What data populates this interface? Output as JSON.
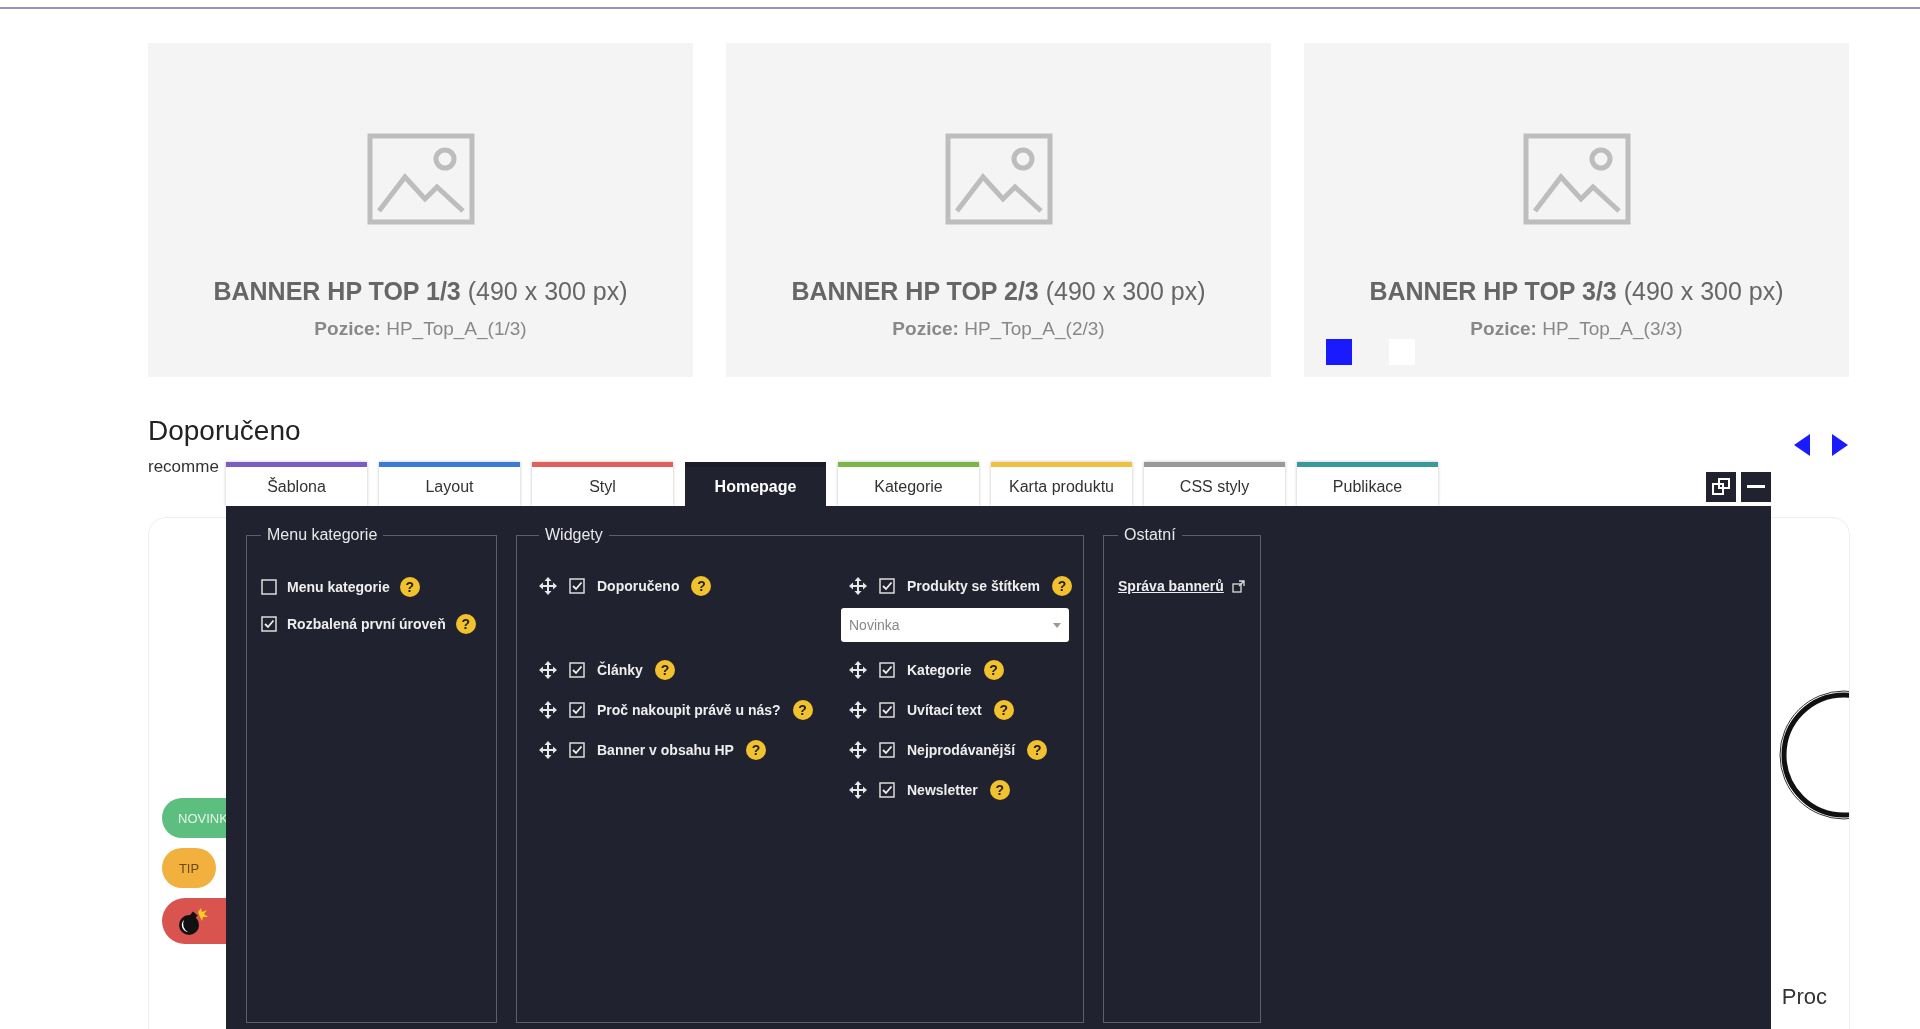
{
  "banners": [
    {
      "title": "**BANNER HP TOP 1/3** (490 x 300 px)",
      "position": "**Pozice:** HP_Top_A_(1/3)"
    },
    {
      "title": "**BANNER HP TOP 2/3** (490 x 300 px)",
      "position": "**Pozice:** HP_Top_A_(2/3)"
    },
    {
      "title": "**BANNER HP TOP 3/3** (490 x 300 px)",
      "position": "**Pozice:** HP_Top_A_(3/3)",
      "slider_dots": [
        {
          "selected": true
        },
        {
          "selected": false
        }
      ]
    }
  ],
  "section": {
    "title": "Doporučeno",
    "subtitle": "recomme"
  },
  "badges": [
    {
      "kind": "label",
      "label": "NOVINK",
      "color": "#5cbf7f"
    },
    {
      "kind": "label",
      "label": "TIP",
      "color": "#f2b13e"
    },
    {
      "kind": "bomb",
      "color": "#d9534f"
    }
  ],
  "side_text": "Proc",
  "editor": {
    "tabs": [
      {
        "label": "Šablona",
        "color": "#7b5cc4",
        "selected": false
      },
      {
        "label": "Layout",
        "color": "#3a7bd5",
        "selected": false
      },
      {
        "label": "Styl",
        "color": "#e0605a",
        "selected": false
      },
      {
        "label": "Homepage",
        "color": "#1c1c28",
        "selected": true
      },
      {
        "label": "Kategorie",
        "color": "#7ab648",
        "selected": false
      },
      {
        "label": "Karta produktu",
        "color": "#f0c040",
        "selected": false
      },
      {
        "label": "CSS styly",
        "color": "#999999",
        "selected": false
      },
      {
        "label": "Publikace",
        "color": "#3a9a9a",
        "selected": false
      }
    ],
    "menu_kategorie": {
      "legend": "Menu kategorie",
      "options": [
        {
          "label": "Menu kategorie",
          "checked": false,
          "help": "?"
        },
        {
          "label": "Rozbalená první úroveň",
          "checked": true,
          "help": "?"
        }
      ]
    },
    "widgety": {
      "legend": "Widgety",
      "columns": [
        [
          {
            "label": "Doporučeno",
            "checked": true,
            "help": "?"
          },
          {
            "label": "Články",
            "checked": true,
            "help": "?"
          },
          {
            "label": "Proč nakoupit právě u nás?",
            "checked": true,
            "help": "?"
          },
          {
            "label": "Banner v obsahu HP",
            "checked": true,
            "help": "?"
          }
        ],
        [
          {
            "label": "Produkty se štítkem",
            "checked": true,
            "help": "?",
            "select": {
              "value": "Novinka"
            }
          },
          {
            "label": "Kategorie",
            "checked": true,
            "help": "?"
          },
          {
            "label": "Uvítací text",
            "checked": true,
            "help": "?"
          },
          {
            "label": "Nejprodávanější",
            "checked": true,
            "help": "?"
          },
          {
            "label": "Newsletter",
            "checked": true,
            "help": "?"
          }
        ]
      ]
    },
    "ostatni": {
      "legend": "Ostatní",
      "link": "Správa bannerů"
    }
  }
}
